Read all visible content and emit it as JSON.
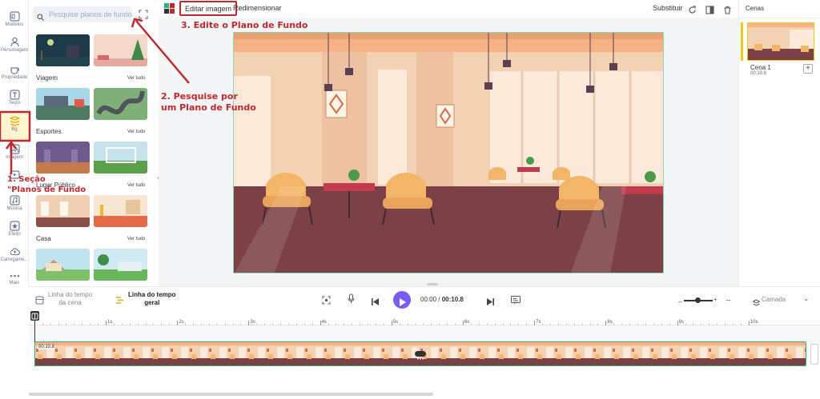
{
  "rail": {
    "items": [
      {
        "label": "Modelos",
        "icon": "templates-icon"
      },
      {
        "label": "Personagem",
        "icon": "character-icon"
      },
      {
        "label": "Propriedade",
        "icon": "props-icon"
      },
      {
        "label": "Texto",
        "icon": "text-icon"
      },
      {
        "label": "Bg",
        "icon": "background-icon"
      },
      {
        "label": "Imagem",
        "icon": "image-icon"
      },
      {
        "label": "",
        "icon": "video-icon"
      },
      {
        "label": "Música",
        "icon": "music-icon"
      },
      {
        "label": "Efeito",
        "icon": "effect-icon"
      },
      {
        "label": "Carregame...",
        "icon": "upload-icon"
      },
      {
        "label": "Mais",
        "icon": "more-icon"
      }
    ]
  },
  "panel": {
    "search_placeholder": "Pesquise planos de fundo",
    "categories": [
      {
        "name": "Viagem",
        "see_all": "Ver tudo"
      },
      {
        "name": "Esportes",
        "see_all": "Ver tudo"
      },
      {
        "name": "Lugar Público",
        "see_all": "Ver tudo"
      },
      {
        "name": "Casa",
        "see_all": "Ver tudo"
      }
    ]
  },
  "toolbar": {
    "edit_image": "Editar imagem",
    "resize": "Redimensionar",
    "replace": "Substituir"
  },
  "scenes": {
    "title": "Cenas",
    "scene_name": "Cena 1",
    "scene_time": "00:10.8"
  },
  "timeline": {
    "scene_timeline": "Linha do tempo da cena",
    "scene_timeline_l1": "Linha do tempo",
    "scene_timeline_l2": "da cena",
    "general_l1": "Linha do tempo",
    "general_l2": "geral",
    "current_time": "00:00",
    "separator": "/",
    "total_time": "00:10.8",
    "layer": "Camada",
    "track_time": "00:10.8",
    "ticks": [
      "1s",
      "2s",
      "3s",
      "4s",
      "5s",
      "6s",
      "7s",
      "8s",
      "9s",
      "10s"
    ]
  },
  "annotations": {
    "step1_l1": "1. Seção",
    "step1_l2": "\"Planos de Fundo",
    "step2_l1": "2. Pesquise por",
    "step2_l2": "um Plano de Fundo",
    "step3": "3. Edite o Plano de Fundo"
  },
  "colors": {
    "accent": "#7b5cf0",
    "annotation": "#c0282e",
    "selection": "#2fb36c",
    "active": "#f5c518"
  }
}
